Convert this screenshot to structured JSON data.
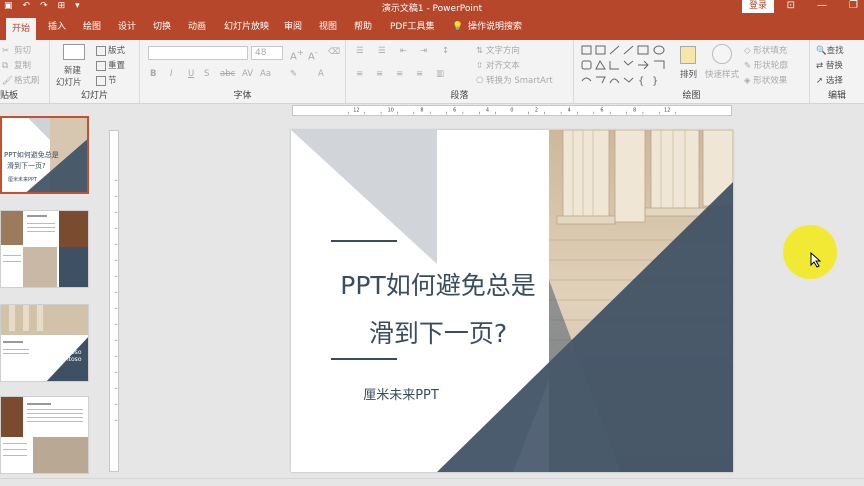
{
  "titlebar": {
    "title": "演示文稿1  -  PowerPoint",
    "login": "登录"
  },
  "tabs": [
    "开始",
    "插入",
    "绘图",
    "设计",
    "切换",
    "动画",
    "幻灯片放映",
    "审阅",
    "视图",
    "帮助",
    "PDF工具集",
    "操作说明搜索"
  ],
  "ribbon": {
    "clipboard": {
      "cut": "剪切",
      "copy": "复制",
      "format_painter": "格式刷",
      "label": "贴板"
    },
    "slides": {
      "new_slide": "新建",
      "new_slide2": "幻灯片",
      "layout": "版式",
      "reset": "重置",
      "section": "节",
      "label": "幻灯片"
    },
    "font": {
      "size": "48",
      "label": "字体"
    },
    "paragraph": {
      "text_direction": "文字方向",
      "align_text": "对齐文本",
      "smartart": "转换为 SmartArt",
      "label": "段落"
    },
    "drawing": {
      "arrange": "排列",
      "quick_styles": "快速样式",
      "shape_fill": "形状填充",
      "shape_outline": "形状轮廓",
      "shape_effects": "形状效果",
      "label": "绘图"
    },
    "editing": {
      "find": "查找",
      "replace": "替换",
      "select": "选择",
      "label": "编辑"
    }
  },
  "slide": {
    "title_line1": "PPT如何避免总是",
    "title_line2": "滑到下一页?",
    "subtitle": "厘米未来PPT"
  },
  "thumbs": {
    "t1_line1": "PPT如何避免总是",
    "t1_line2": "滑到下一页?",
    "t1_sub": "厘米未来PPT",
    "t3_text1": "Contoso 40",
    "t3_text2": "Contoso"
  },
  "colors": {
    "accent": "#b7472a",
    "slate": "#3a4d60",
    "highlight": "#f2e92b"
  }
}
